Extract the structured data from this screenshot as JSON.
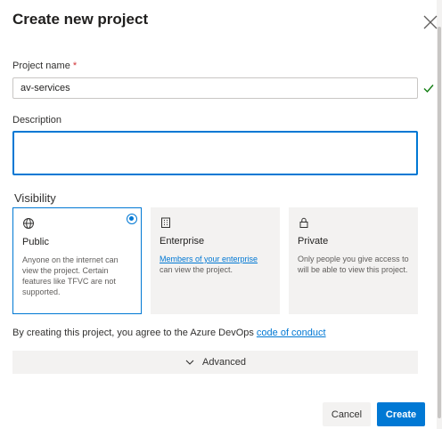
{
  "dialog": {
    "title": "Create new project"
  },
  "project_name": {
    "label": "Project name",
    "required_mark": "*",
    "value": "av-services"
  },
  "description": {
    "label": "Description",
    "value": ""
  },
  "visibility": {
    "label": "Visibility",
    "options": [
      {
        "title": "Public",
        "icon": "globe-icon",
        "description": "Anyone on the internet can view the project. Certain features like TFVC are not supported.",
        "selected": true
      },
      {
        "title": "Enterprise",
        "icon": "building-icon",
        "link_text": "Members of your enterprise",
        "description_suffix": " can view the project.",
        "selected": false
      },
      {
        "title": "Private",
        "icon": "lock-icon",
        "description": "Only people you give access to will be able to view this project.",
        "selected": false
      }
    ]
  },
  "agreement": {
    "text": "By creating this project, you agree to the Azure DevOps ",
    "link_text": "code of conduct"
  },
  "advanced": {
    "label": "Advanced"
  },
  "footer": {
    "cancel_label": "Cancel",
    "create_label": "Create"
  },
  "colors": {
    "accent": "#0078d4",
    "success": "#107c10",
    "required": "#d13438",
    "card_bg": "#f3f2f1"
  }
}
